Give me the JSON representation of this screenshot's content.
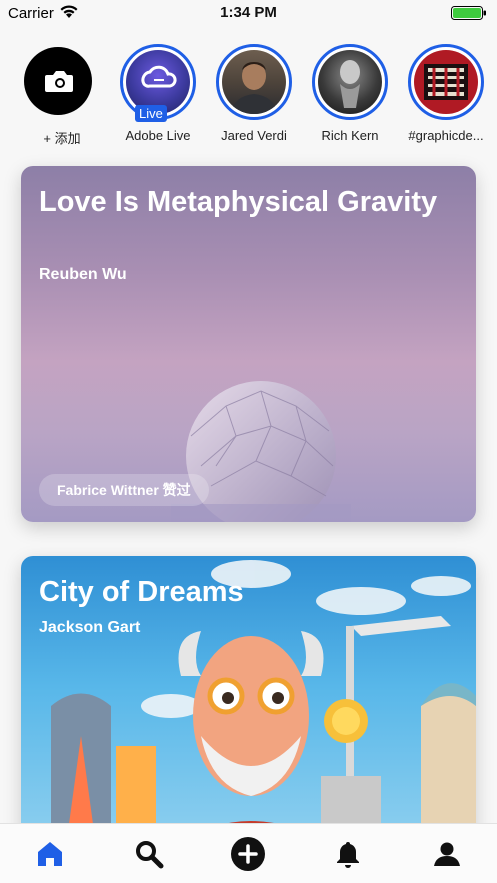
{
  "status_bar": {
    "carrier": "Carrier",
    "time": "1:34 PM"
  },
  "stories": [
    {
      "name": "+ 添加",
      "icon": "camera-icon"
    },
    {
      "name": "Adobe Live",
      "badge": "Live"
    },
    {
      "name": "Jared Verdi"
    },
    {
      "name": "Rich Kern"
    },
    {
      "name": "#graphicde..."
    }
  ],
  "cards": [
    {
      "title": "Love Is Metaphysical Gravity",
      "author": "Reuben Wu",
      "liked_by": "Fabrice Wittner 赞过"
    },
    {
      "title": "City of Dreams",
      "author": "Jackson Gart"
    }
  ],
  "tab_bar": {
    "items": [
      "home-icon",
      "search-icon",
      "add-icon",
      "bell-icon",
      "profile-icon"
    ],
    "active_color": "#1f5fe6"
  },
  "colors": {
    "accent": "#1f5fe6"
  }
}
